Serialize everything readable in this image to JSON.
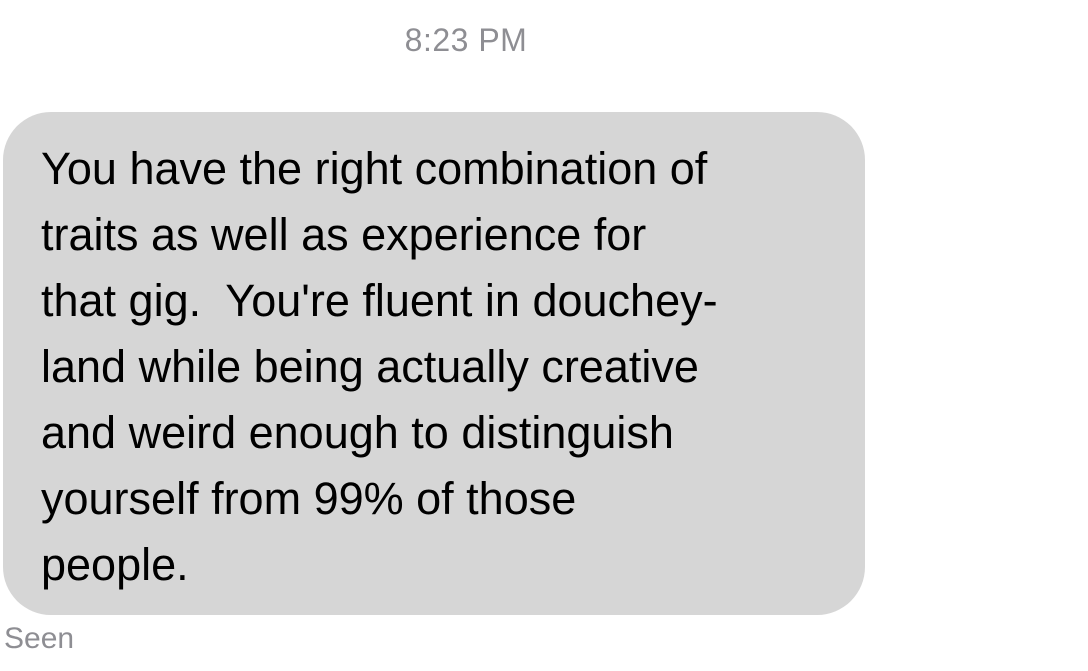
{
  "thread": {
    "timestamp": "8:23 PM",
    "message": {
      "lines": [
        "You have the right combination of",
        "traits as well as experience for",
        "that gig.  You're fluent in douchey-",
        "land while being actually creative",
        "and weird enough to distinguish",
        "yourself from 99% of those",
        "people."
      ]
    },
    "status": "Seen"
  }
}
